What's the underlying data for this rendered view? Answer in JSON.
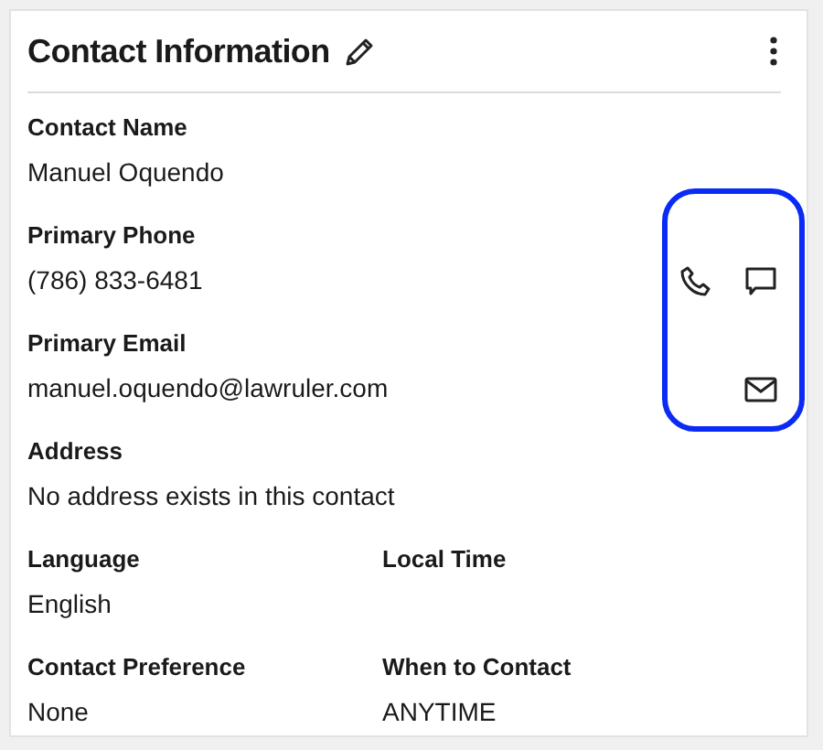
{
  "card": {
    "title": "Contact Information"
  },
  "rows": [
    {
      "fields": [
        {
          "label": "Contact Name",
          "value": "Manuel Oquendo"
        }
      ]
    },
    {
      "fields": [
        {
          "label": "Primary Phone",
          "value": "(786) 833-6481"
        }
      ],
      "actions": [
        {
          "kind": "phone"
        },
        {
          "kind": "message"
        }
      ]
    },
    {
      "fields": [
        {
          "label": "Primary Email",
          "value": "manuel.oquendo@lawruler.com"
        }
      ],
      "actions": [
        {
          "kind": "email"
        }
      ]
    },
    {
      "fields": [
        {
          "label": "Address",
          "value": "No address exists in this contact"
        }
      ]
    },
    {
      "fields": [
        {
          "label": "Language",
          "value": "English"
        },
        {
          "label": "Local Time"
        }
      ]
    },
    {
      "fields": [
        {
          "label": "Contact Preference",
          "value": "None"
        },
        {
          "label": "When to Contact",
          "value": "ANYTIME"
        }
      ]
    }
  ]
}
